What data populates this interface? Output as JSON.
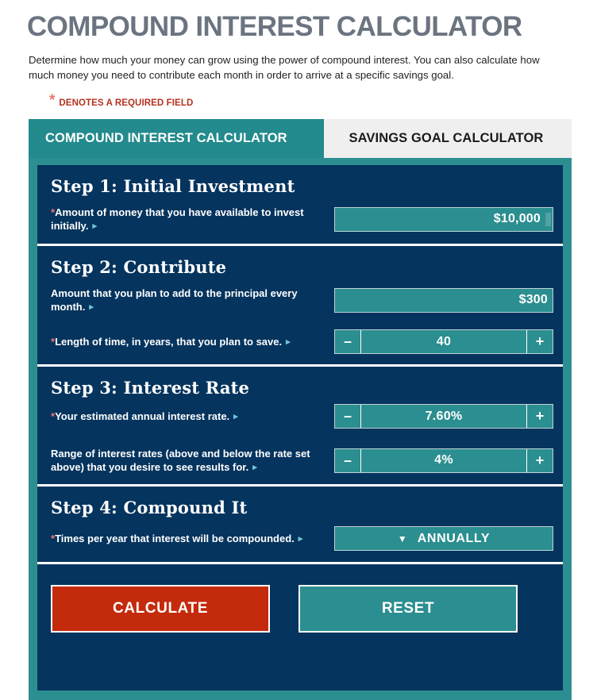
{
  "header": {
    "title": "COMPOUND INTEREST CALCULATOR",
    "description": "Determine how much your money can grow using the power of compound interest. You can also calculate how much money you need to contribute each month in order to arrive at a specific savings goal.",
    "required_star": "*",
    "required_note": "DENOTES A REQUIRED FIELD"
  },
  "tabs": [
    {
      "label": "COMPOUND INTEREST CALCULATOR",
      "active": true
    },
    {
      "label": "SAVINGS GOAL CALCULATOR",
      "active": false
    }
  ],
  "steps": [
    {
      "title": "Step 1: Initial Investment",
      "fields": [
        {
          "required": "*",
          "label": "Amount of money that you have available to invest initially.",
          "help_icon": "▸",
          "type": "text",
          "value": "$10,000"
        }
      ]
    },
    {
      "title": "Step 2: Contribute",
      "fields": [
        {
          "required": "",
          "label": "Amount that you plan to add to the principal every month.",
          "help_icon": "▸",
          "type": "text",
          "value": "$300"
        },
        {
          "required": "*",
          "label": "Length of time, in years, that you plan to save.",
          "help_icon": "▸",
          "type": "stepper",
          "value": "40",
          "decrement": "–",
          "increment": "+"
        }
      ]
    },
    {
      "title": "Step 3: Interest Rate",
      "fields": [
        {
          "required": "*",
          "label": "Your estimated annual interest rate.",
          "help_icon": "▸",
          "type": "stepper",
          "value": "7.60%",
          "decrement": "–",
          "increment": "+"
        },
        {
          "required": "",
          "label": "Range of interest rates (above and below the rate set above) that you desire to see results for.",
          "help_icon": "▸",
          "type": "stepper",
          "value": "4%",
          "decrement": "–",
          "increment": "+"
        }
      ]
    },
    {
      "title": "Step 4: Compound It",
      "fields": [
        {
          "required": "*",
          "label": "Times per year that interest will be compounded.",
          "help_icon": "▸",
          "type": "select",
          "value": "ANNUALLY",
          "chevron": "▼"
        }
      ]
    }
  ],
  "actions": {
    "calculate_label": "CALCULATE",
    "reset_label": "RESET"
  },
  "colors": {
    "teal": "#2b8e90",
    "tab_teal": "#238a8d",
    "navy": "#05345e",
    "red": "#c42a0c",
    "required_star": "#e8796a",
    "required_text": "#b4321f",
    "title_gray": "#6b7480",
    "tab_inactive_bg": "#efefef"
  }
}
